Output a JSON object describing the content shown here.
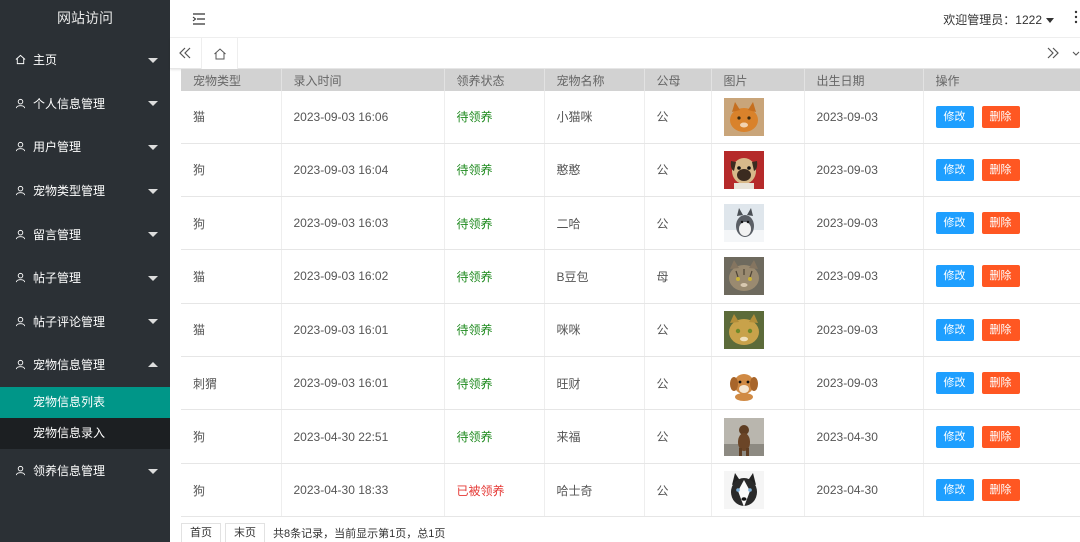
{
  "sidebar": {
    "title": "网站访问",
    "items": [
      {
        "label": "主页",
        "icon": "home-icon"
      },
      {
        "label": "个人信息管理",
        "icon": "user-icon"
      },
      {
        "label": "用户管理",
        "icon": "user-icon"
      },
      {
        "label": "宠物类型管理",
        "icon": "user-icon"
      },
      {
        "label": "留言管理",
        "icon": "user-icon"
      },
      {
        "label": "帖子管理",
        "icon": "user-icon"
      },
      {
        "label": "帖子评论管理",
        "icon": "user-icon"
      },
      {
        "label": "宠物信息管理",
        "icon": "user-icon"
      }
    ],
    "sub_items": [
      {
        "label": "宠物信息列表"
      },
      {
        "label": "宠物信息录入"
      }
    ],
    "last_item": {
      "label": "领养信息管理",
      "icon": "user-icon"
    }
  },
  "header": {
    "user_label": "欢迎管理员：1222"
  },
  "table": {
    "headers": [
      "宠物类型",
      "录入时间",
      "领养状态",
      "宠物名称",
      "公母",
      "图片",
      "出生日期",
      "操作"
    ],
    "rows": [
      {
        "type": "猫",
        "time": "2023-09-03 16:06",
        "status": "待领养",
        "name": "小猫咪",
        "sex": "公",
        "birth": "2023-09-03"
      },
      {
        "type": "狗",
        "time": "2023-09-03 16:04",
        "status": "待领养",
        "name": "憨憨",
        "sex": "公",
        "birth": "2023-09-03"
      },
      {
        "type": "狗",
        "time": "2023-09-03 16:03",
        "status": "待领养",
        "name": "二哈",
        "sex": "公",
        "birth": "2023-09-03"
      },
      {
        "type": "猫",
        "time": "2023-09-03 16:02",
        "status": "待领养",
        "name": "B豆包",
        "sex": "母",
        "birth": "2023-09-03"
      },
      {
        "type": "猫",
        "time": "2023-09-03 16:01",
        "status": "待领养",
        "name": "咪咪",
        "sex": "公",
        "birth": "2023-09-03"
      },
      {
        "type": "刺猬",
        "time": "2023-09-03 16:01",
        "status": "待领养",
        "name": "旺财",
        "sex": "公",
        "birth": "2023-09-03"
      },
      {
        "type": "狗",
        "time": "2023-04-30 22:51",
        "status": "待领养",
        "name": "来福",
        "sex": "公",
        "birth": "2023-04-30"
      },
      {
        "type": "狗",
        "time": "2023-04-30 18:33",
        "status": "已被领养",
        "name": "哈士奇",
        "sex": "公",
        "birth": "2023-04-30"
      }
    ],
    "edit_label": "修改",
    "delete_label": "删除"
  },
  "pager": {
    "first_label": "首页",
    "last_label": "末页",
    "info": "共8条记录，当前显示第1页，总1页"
  },
  "colors": {
    "sidebar_bg": "#2b3035",
    "active_sub": "#009688",
    "edit_btn": "#1e9fff",
    "delete_btn": "#ff5722",
    "status_ok": "#1e8a1e",
    "status_taken": "#e53935"
  }
}
